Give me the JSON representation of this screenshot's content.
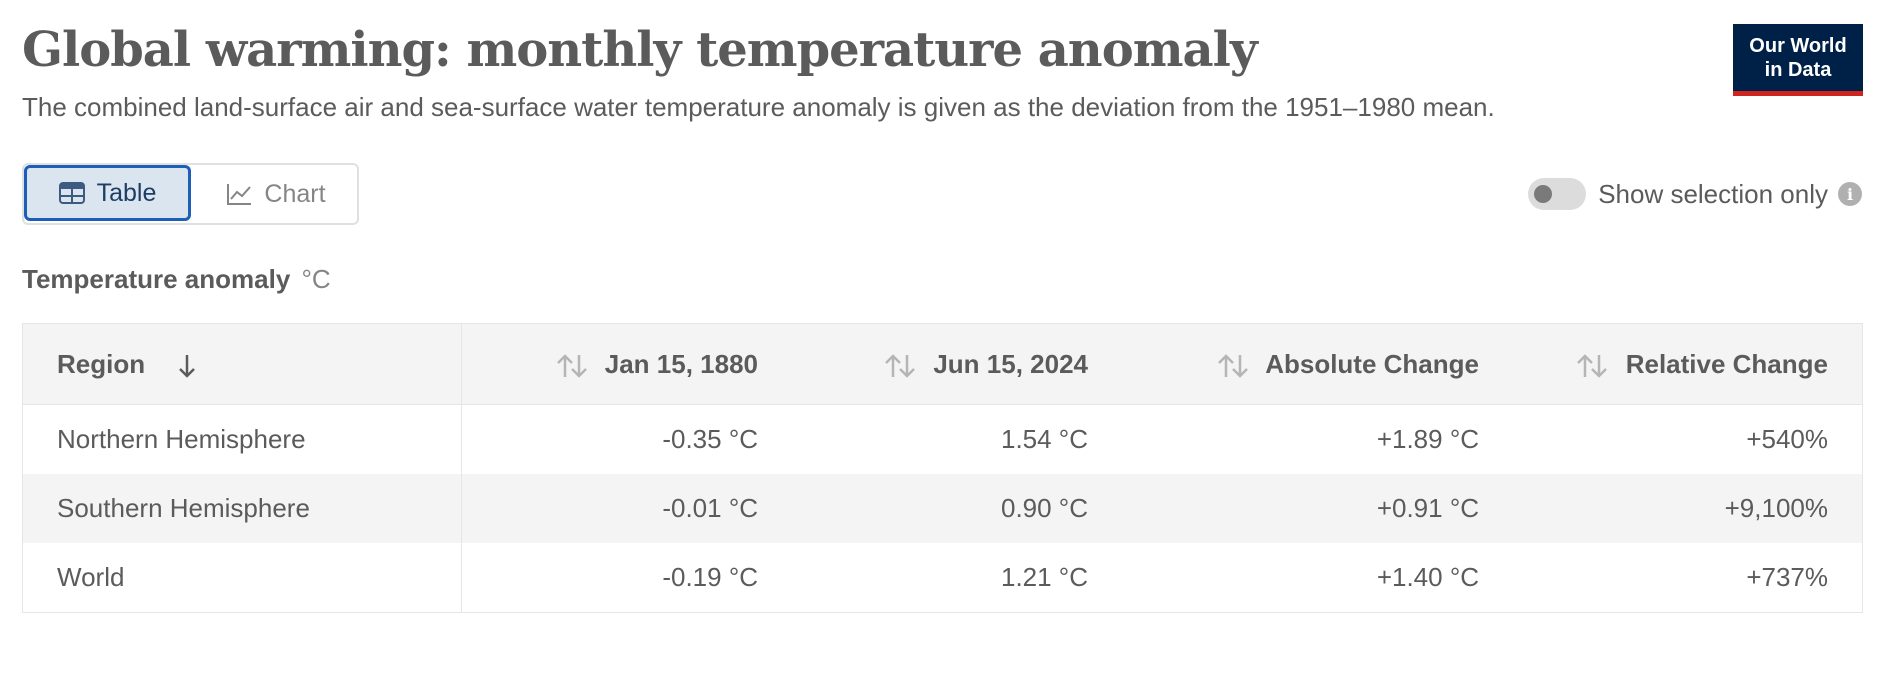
{
  "header": {
    "title": "Global warming: monthly temperature anomaly",
    "subtitle": "The combined land-surface air and sea-surface water temperature anomaly is given as the deviation from the 1951–1980 mean.",
    "logo_line1": "Our World",
    "logo_line2": "in Data"
  },
  "tabs": {
    "table_label": "Table",
    "chart_label": "Chart",
    "active": "Table"
  },
  "selection": {
    "label": "Show selection only",
    "enabled": false
  },
  "table": {
    "caption_label": "Temperature anomaly",
    "caption_unit": "°C",
    "columns": [
      "Region",
      "Jan 15, 1880",
      "Jun 15, 2024",
      "Absolute Change",
      "Relative Change"
    ],
    "rows": [
      [
        "Northern Hemisphere",
        "-0.35 °C",
        "1.54 °C",
        "+1.89 °C",
        "+540%"
      ],
      [
        "Southern Hemisphere",
        "-0.01 °C",
        "0.90 °C",
        "+0.91 °C",
        "+9,100%"
      ],
      [
        "World",
        "-0.19 °C",
        "1.21 °C",
        "+1.40 °C",
        "+737%"
      ]
    ]
  },
  "colors": {
    "brand_navy": "#002147",
    "brand_red": "#ce261e",
    "active_tab_border": "#1d5fb6",
    "active_tab_bg": "#dbe5f0"
  }
}
